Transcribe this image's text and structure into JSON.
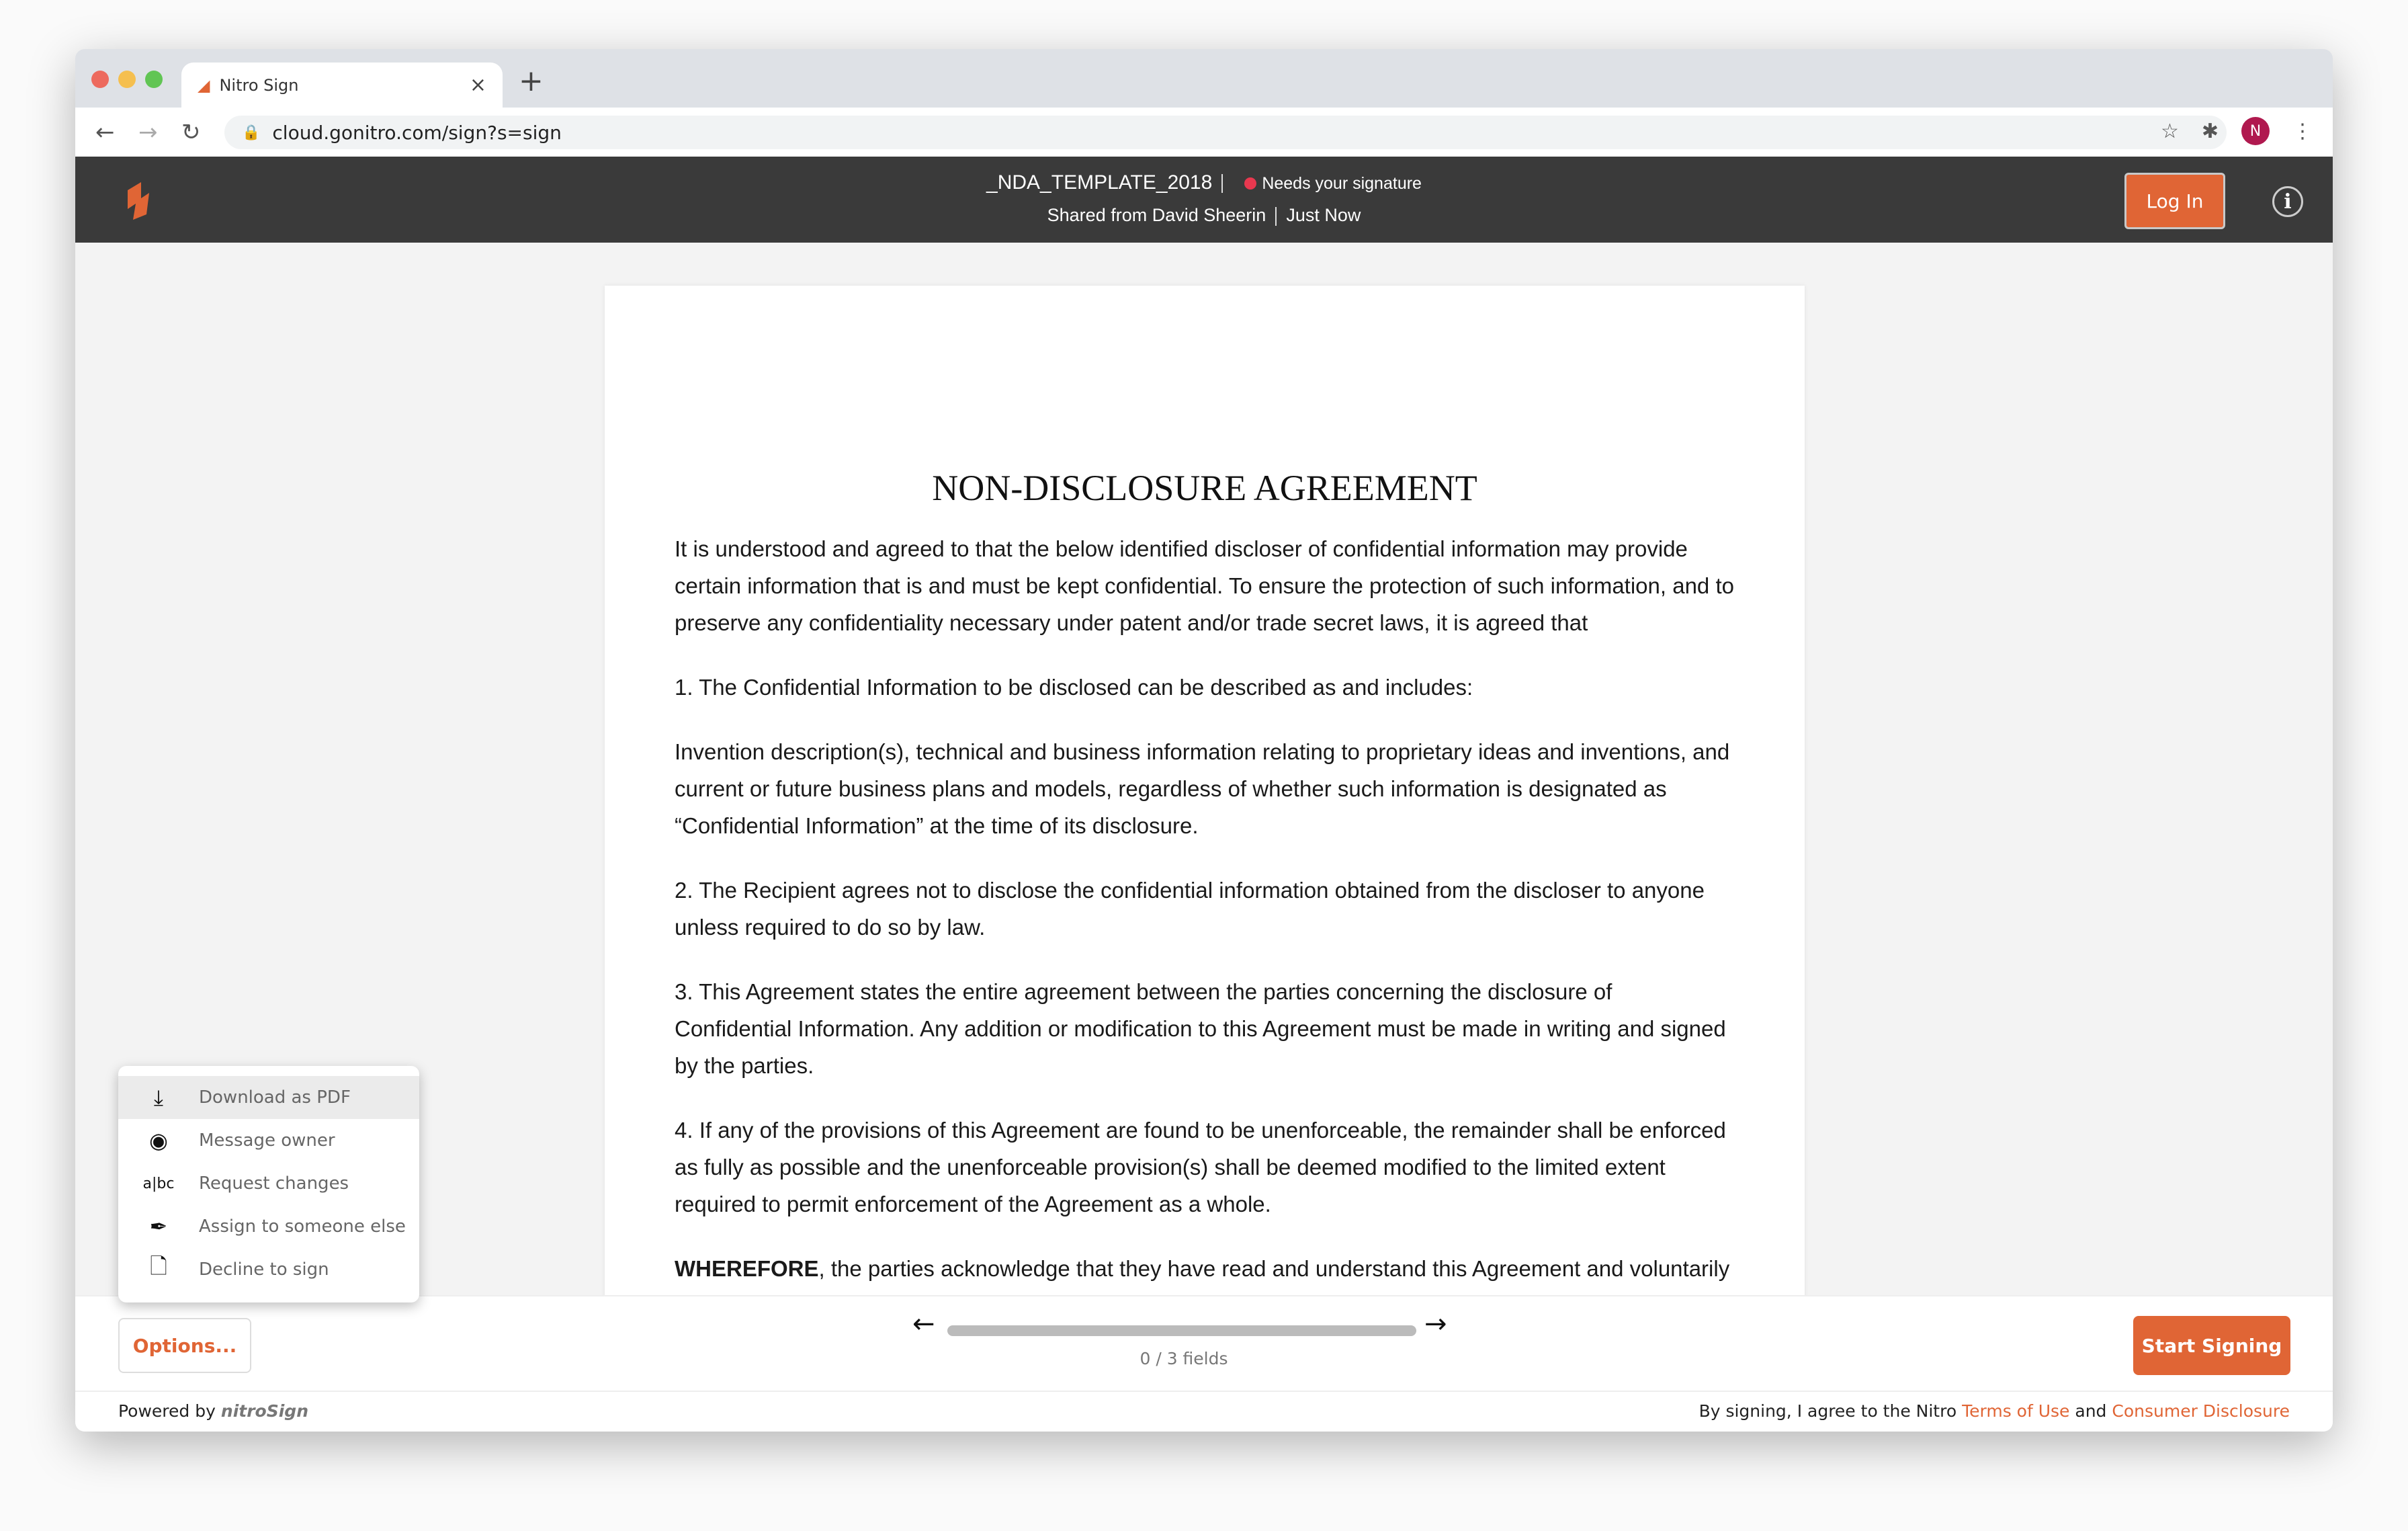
{
  "browser": {
    "tab_title": "Nitro Sign",
    "url": "cloud.gonitro.com/sign?s=sign",
    "avatar_letter": "N"
  },
  "header": {
    "doc_name": "_NDA_TEMPLATE_2018",
    "status": "Needs your signature",
    "shared_from": "Shared from David Sheerin",
    "time": "Just Now",
    "login": "Log In",
    "status_color": "#e8384f",
    "accent": "#e06535"
  },
  "document": {
    "title": "NON-DISCLOSURE AGREEMENT",
    "paragraphs": [
      "It is understood and agreed to that the below identified discloser of confidential information may provide certain information that is and must be kept confidential. To ensure the protection of such information, and to preserve any confidentiality necessary under patent and/or trade secret laws, it is agreed that",
      "1. The Confidential Information to be disclosed can be described as and includes:",
      "Invention description(s), technical and business information relating to proprietary ideas and inventions, and current or future business plans and models, regardless of whether such information is designated as “Confidential Information” at the time of its disclosure.",
      "2. The Recipient agrees not to disclose the confidential information obtained from the discloser to anyone unless required to do so by law.",
      "3. This Agreement states the entire agreement between the parties concerning the disclosure of Confidential Information. Any addition or modification to this Agreement must be made in writing and signed by the parties.",
      "4. If any of the provisions of this Agreement are found to be unenforceable, the remainder shall be enforced as fully as possible and the unenforceable provision(s) shall be deemed modified to the limited extent required to permit enforcement of the Agreement as a whole."
    ],
    "last_bold": "WHEREFORE",
    "last_rest": ", the parties acknowledge that they have read and understand this Agreement and voluntarily"
  },
  "menu": {
    "items": [
      {
        "label": "Download as PDF",
        "icon": "download-icon"
      },
      {
        "label": "Message owner",
        "icon": "user-icon"
      },
      {
        "label": "Request changes",
        "icon": "text-cursor-icon"
      },
      {
        "label": "Assign to someone else",
        "icon": "pen-forward-icon"
      },
      {
        "label": "Decline to sign",
        "icon": "document-trash-icon"
      }
    ]
  },
  "bottom": {
    "options": "Options...",
    "fields": "0 / 3 fields",
    "progress": 0,
    "start": "Start Signing",
    "prev": "←",
    "next": "→"
  },
  "footer": {
    "powered": "Powered by",
    "brand": "nitroSign",
    "agree": "By signing, I agree to the Nitro",
    "terms": "Terms of Use",
    "and": "and",
    "disclosure": "Consumer Disclosure"
  }
}
